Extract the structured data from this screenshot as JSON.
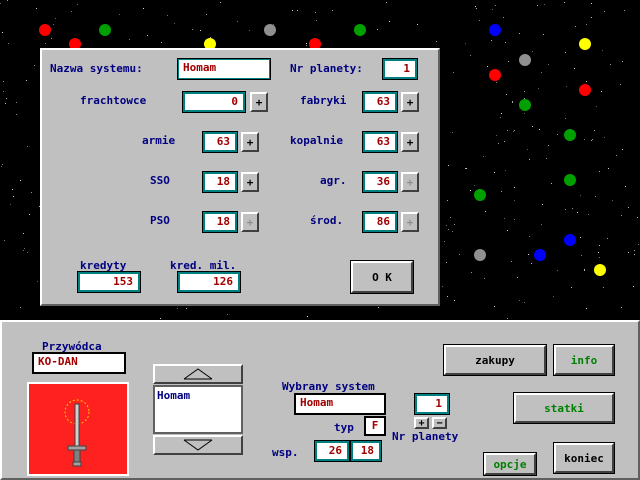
{
  "system_dialog": {
    "system_name_label": "Nazwa systemu:",
    "system_name_value": "Homam",
    "planet_no_label": "Nr planety:",
    "planet_no_value": "1",
    "frachtowce_label": "frachtowce",
    "frachtowce_value": "0",
    "fabryki_label": "fabryki",
    "fabryki_value": "63",
    "armie_label": "armie",
    "armie_value": "63",
    "kopalnie_label": "kopalnie",
    "kopalnie_value": "63",
    "sso_label": "SSO",
    "sso_value": "18",
    "agr_label": "agr.",
    "agr_value": "36",
    "pso_label": "PSO",
    "pso_value": "18",
    "srod_label": "środ.",
    "srod_value": "86",
    "kredyty_label": "kredyty",
    "kredyty_value": "153",
    "kred_mil_label": "kred. mil.",
    "kred_mil_value": "126",
    "ok_label": "O K",
    "plus": "+"
  },
  "bottom_panel": {
    "leader_label": "Przywódca",
    "leader_value": "KO-DAN",
    "systems_list": [
      "Homam"
    ],
    "selected_system_label": "Wybrany system",
    "selected_system_value": "Homam",
    "typ_label": "typ",
    "typ_value": "F",
    "planet_no_value": "1",
    "plus": "+",
    "minus": "−",
    "planet_no_label": "Nr planety",
    "wsp_label": "wsp.",
    "wsp_x": "26",
    "wsp_y": "18",
    "zakupy_label": "zakupy",
    "info_label": "info",
    "statki_label": "statki",
    "opcje_label": "opcje",
    "koniec_label": "koniec"
  },
  "colors": {
    "panel": "#c0c0c0",
    "label": "#000080",
    "value": "#a00000",
    "field_border": "#008080",
    "flag_bg": "#ff2020"
  },
  "icons": [
    "scroll-up-icon",
    "scroll-down-icon",
    "sword-emblem-icon"
  ]
}
